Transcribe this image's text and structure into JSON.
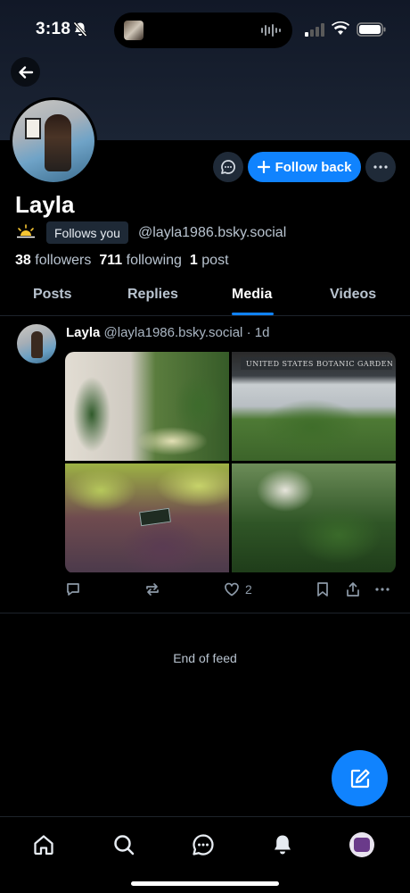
{
  "status_bar": {
    "time": "3:18"
  },
  "profile": {
    "name": "Layla",
    "follows_you": "Follows you",
    "handle": "@layla1986.bsky.social",
    "followers_count": "38",
    "followers_label": "followers",
    "following_count": "711",
    "following_label": "following",
    "posts_count": "1",
    "posts_label": "post",
    "follow_back_label": "Follow back"
  },
  "tabs": [
    "Posts",
    "Replies",
    "Media",
    "Videos"
  ],
  "active_tab": "Media",
  "post": {
    "author": "Layla",
    "handle": "@layla1986.bsky.social",
    "time": "· 1d",
    "sign_text": "UNITED STATES BOTANIC GARDEN",
    "like_count": "2"
  },
  "end_of_feed": "End of feed",
  "colors": {
    "accent": "#1083fe",
    "background": "#000000",
    "muted_text": "#b9c4d0"
  },
  "icons": [
    "bell-off-icon",
    "signal-icon",
    "wifi-icon",
    "battery-icon",
    "back-arrow-icon",
    "chat-icon",
    "plus-icon",
    "more-icon",
    "sun-icon",
    "reply-icon",
    "repost-icon",
    "heart-icon",
    "bookmark-icon",
    "share-icon",
    "compose-icon",
    "home-icon",
    "search-icon",
    "notifications-icon"
  ]
}
